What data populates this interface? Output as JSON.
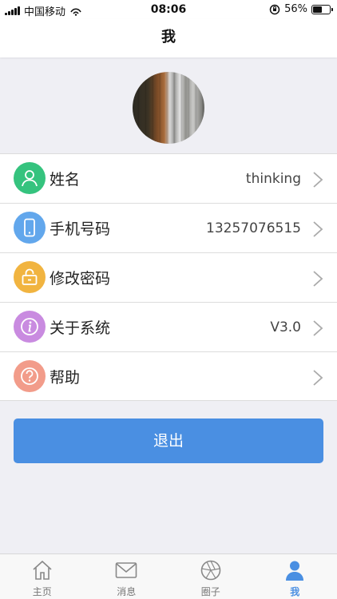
{
  "status_bar": {
    "carrier": "中国移动",
    "time": "08:06",
    "battery": "56%",
    "battery_level": 0.56
  },
  "header": {
    "title": "我"
  },
  "profile": {
    "avatar_icon": "avatar-photo"
  },
  "menu": {
    "items": [
      {
        "label": "姓名",
        "value": "thinking",
        "icon": "person-icon",
        "color": "#35c37e"
      },
      {
        "label": "手机号码",
        "value": "13257076515",
        "icon": "phone-icon",
        "color": "#62a7ec"
      },
      {
        "label": "修改密码",
        "value": "",
        "icon": "lock-icon",
        "color": "#f1b440"
      },
      {
        "label": "关于系统",
        "value": "V3.0",
        "icon": "info-icon",
        "color": "#c98be0"
      },
      {
        "label": "帮助",
        "value": "",
        "icon": "help-icon",
        "color": "#f29c8a"
      }
    ]
  },
  "logout": {
    "label": "退出",
    "color": "#4a8fe2"
  },
  "tabbar": {
    "tabs": [
      {
        "label": "主页",
        "icon": "home-icon"
      },
      {
        "label": "消息",
        "icon": "mail-icon"
      },
      {
        "label": "圈子",
        "icon": "aperture-icon"
      },
      {
        "label": "我",
        "icon": "user-icon",
        "active": true
      }
    ],
    "active_color": "#4a8fe2"
  }
}
